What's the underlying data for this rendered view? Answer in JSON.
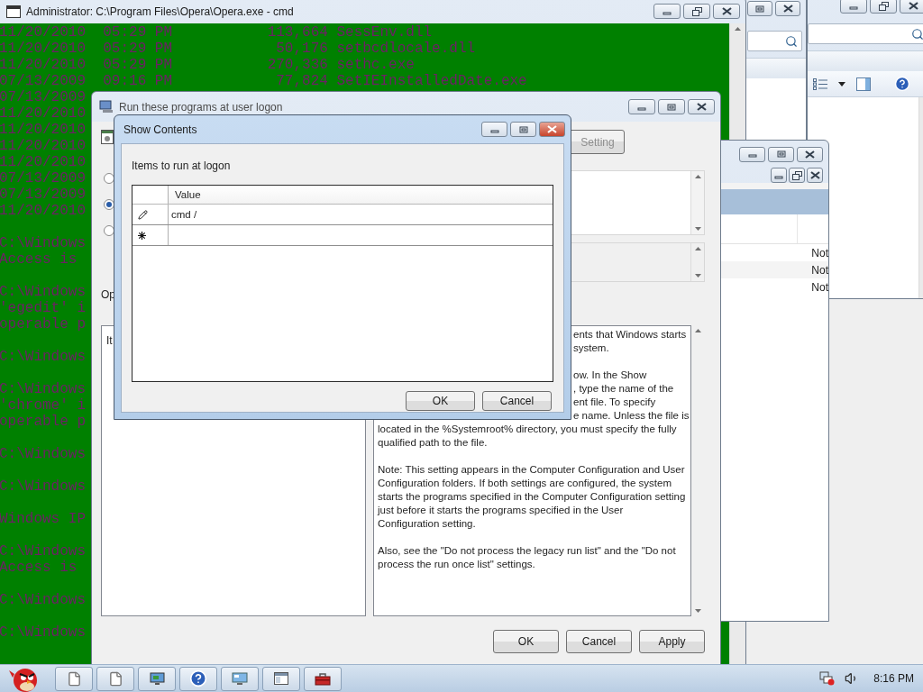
{
  "cmd_window": {
    "title": "Administrator: C:\\Program Files\\Opera\\Opera.exe - cmd",
    "blocks": [
      [
        "11/20/2010  05:29 PM           113,664 SessEnv.dll",
        "11/20/2010  05:29 PM            50,176 setbcdlocale.dll",
        "11/20/2010  05:29 PM           270,336 sethc.exe",
        "07/13/2009  09:16 PM            77,824 SetIEInstalledDate.exe",
        "07/13/2009",
        "11/20/2010",
        "11/20/2010",
        "11/20/2010",
        "11/20/2010",
        "07/13/2009",
        "07/13/2009",
        "11/20/2010"
      ],
      [
        "C:\\Windows",
        "Access is"
      ],
      [
        "C:\\Windows",
        "'egedit' i",
        "operable p"
      ],
      [
        "C:\\Windows"
      ],
      [
        "C:\\Windows",
        "'chrome' i",
        "operable p"
      ],
      [
        "C:\\Windows"
      ],
      [
        "C:\\Windows"
      ],
      [
        "Windows IP"
      ],
      [
        "C:\\Windows",
        "Access is"
      ],
      [
        "C:\\Windows"
      ],
      [
        "C:\\Windows"
      ]
    ]
  },
  "background_list": {
    "items": [
      "Not",
      "Not",
      "Not"
    ]
  },
  "policy_dialog": {
    "title": "Run these programs at user logon",
    "setting_button": "Setting",
    "radios": [
      {
        "selected": false
      },
      {
        "selected": true
      },
      {
        "selected": false
      }
    ],
    "options_label": "Op",
    "options_box_text": "It",
    "help_text": {
      "partial_blocks": [
        [
          "ents that Windows starts",
          "system."
        ],
        [
          "ow. In the Show",
          ", type the name of the",
          "ent file. To specify",
          "e name. Unless the file is"
        ]
      ],
      "continuation": "located in the %Systemroot% directory, you must specify the fully qualified path to the file.",
      "paragraphs": [
        "Note: This setting appears in the Computer Configuration and User Configuration folders. If both settings are configured, the system starts the programs specified in the Computer Configuration setting just before it starts the programs specified in the User Configuration setting.",
        "Also, see the \"Do not process the legacy run list\" and the \"Do not process the run once list\" settings."
      ]
    },
    "buttons": [
      "OK",
      "Cancel",
      "Apply"
    ]
  },
  "show_contents": {
    "title": "Show Contents",
    "label": "Items to run at logon",
    "column": "Value",
    "rows": [
      {
        "kind": "entry",
        "value": "cmd /"
      },
      {
        "kind": "new"
      }
    ],
    "buttons": [
      "OK",
      "Cancel"
    ]
  },
  "taskbar": {
    "clock": "8:16 PM"
  }
}
